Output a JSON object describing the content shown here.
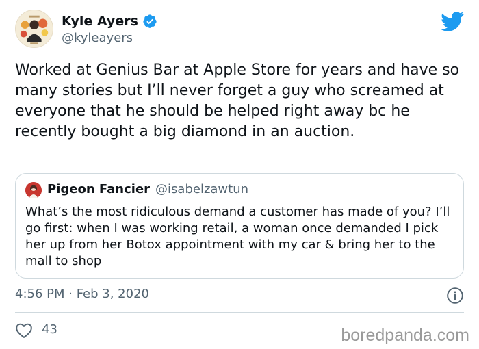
{
  "author": {
    "name": "Kyle Ayers",
    "handle": "@kyleayers",
    "avatar": "avatar-photo",
    "verified_icon": "verified-badge-icon"
  },
  "platform_icon": "twitter-bird-icon",
  "tweet": {
    "text": "Worked at Genius Bar at Apple Store for years and have so many stories but I’ll never forget a guy who screamed at everyone that he should be helped right away bc he recently bought a big diamond in an auction."
  },
  "quoted_tweet": {
    "name": "Pigeon Fancier",
    "handle": "@isabelzawtun",
    "avatar": "avatar-photo",
    "text": "What’s the most ridiculous demand a customer has made of you? I’ll go first: when I was working retail, a woman once demanded I pick her up from her Botox appointment with my car & bring her to the mall to shop"
  },
  "meta": {
    "timestamp": "4:56 PM · Feb 3, 2020",
    "info_icon": "info-icon"
  },
  "actions": {
    "like_icon": "heart-icon",
    "like_count": "43"
  },
  "watermark": "boredpanda.com",
  "colors": {
    "twitter_blue": "#1d9bf0",
    "text_primary": "#0f1419",
    "text_secondary": "#536471",
    "border": "#cfd9de"
  }
}
